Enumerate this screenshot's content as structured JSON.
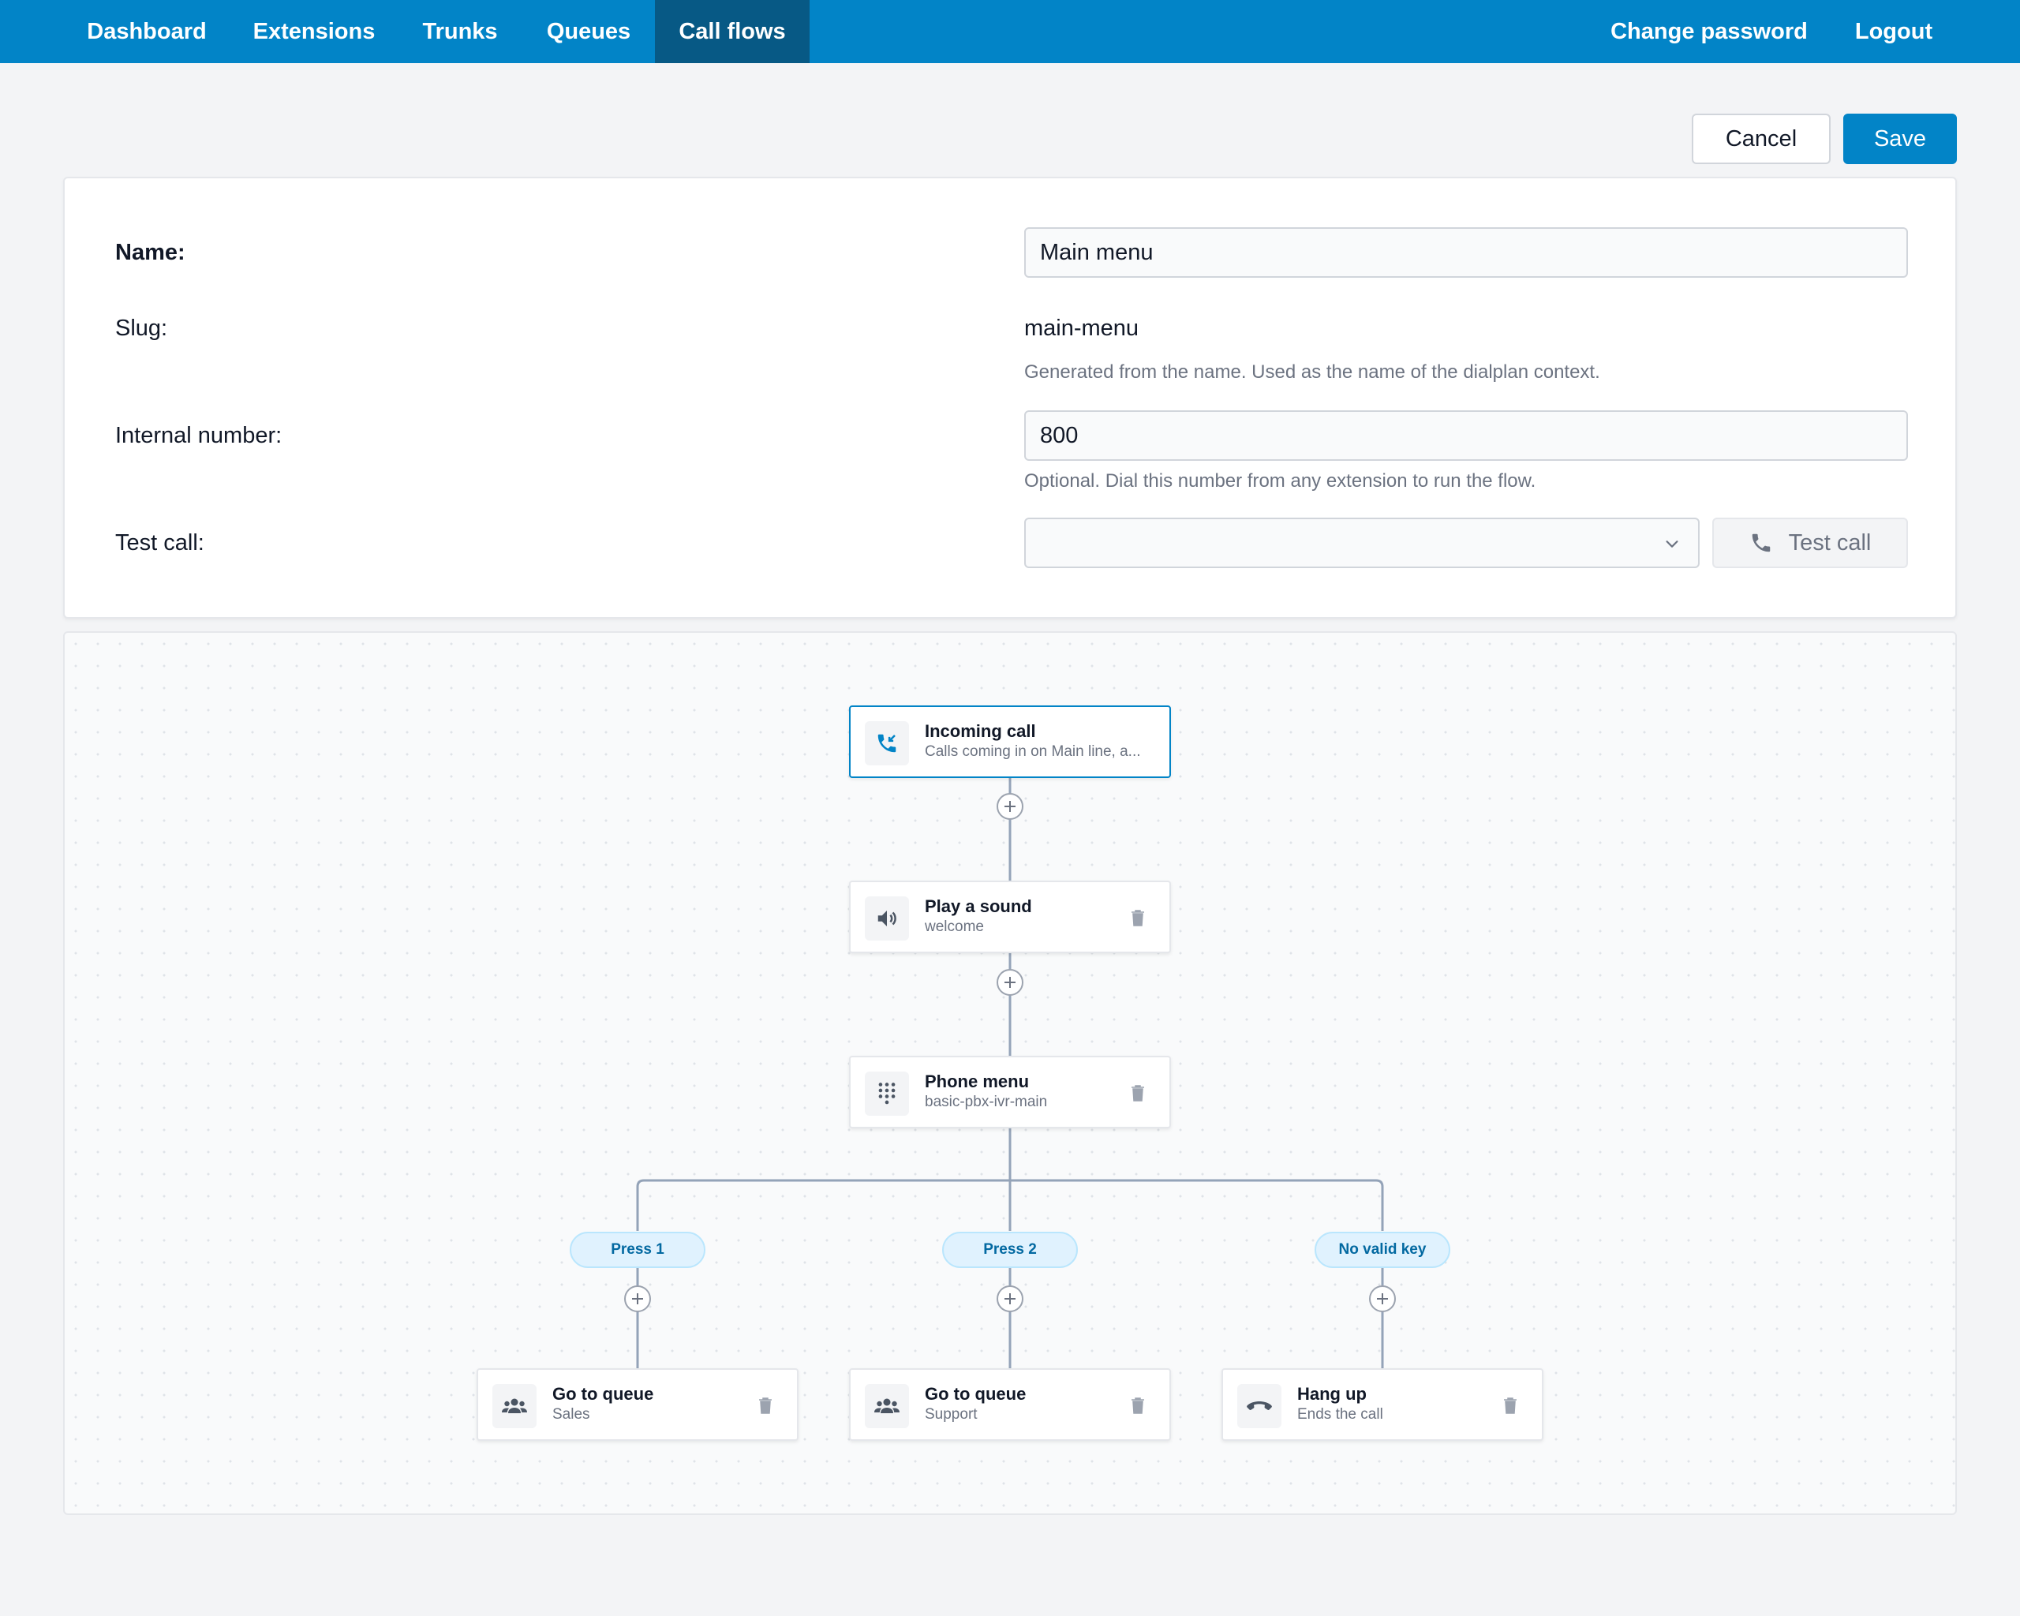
{
  "nav": {
    "left": [
      "Dashboard",
      "Extensions",
      "Trunks",
      "Queues",
      "Call flows"
    ],
    "right": [
      "Change password",
      "Logout"
    ],
    "active": "Call flows"
  },
  "actions": {
    "cancel": "Cancel",
    "save": "Save"
  },
  "form": {
    "name_label": "Name:",
    "name_value": "Main menu",
    "slug_label": "Slug:",
    "slug_value": "main-menu",
    "slug_hint": "Generated from the name. Used as the name of the dialplan context.",
    "internal_label": "Internal number:",
    "internal_value": "800",
    "internal_hint": "Optional. Dial this number from any extension to run the flow.",
    "test_label": "Test call:",
    "test_select_value": "",
    "test_button": "Test call"
  },
  "flow": {
    "nodes": [
      {
        "title": "Incoming call",
        "subtitle": "Calls coming in on Main line, a...",
        "icon": "incoming-call-icon"
      },
      {
        "title": "Play a sound",
        "subtitle": "welcome",
        "icon": "speaker-icon"
      },
      {
        "title": "Phone menu",
        "subtitle": "basic-pbx-ivr-main",
        "icon": "dialpad-icon"
      },
      {
        "title": "Go to queue",
        "subtitle": "Sales",
        "icon": "queue-icon"
      },
      {
        "title": "Go to queue",
        "subtitle": "Support",
        "icon": "queue-icon"
      },
      {
        "title": "Hang up",
        "subtitle": "Ends the call",
        "icon": "hang-up-icon"
      }
    ],
    "branches": [
      "Press 1",
      "Press 2",
      "No valid key"
    ]
  },
  "colors": {
    "nav_bg": "#0284c7",
    "nav_active": "#075985",
    "primary": "#0284c7",
    "connector": "#94a3b8",
    "branch_pill_bg": "#e0f2fe",
    "branch_pill_text": "#0369a1"
  }
}
